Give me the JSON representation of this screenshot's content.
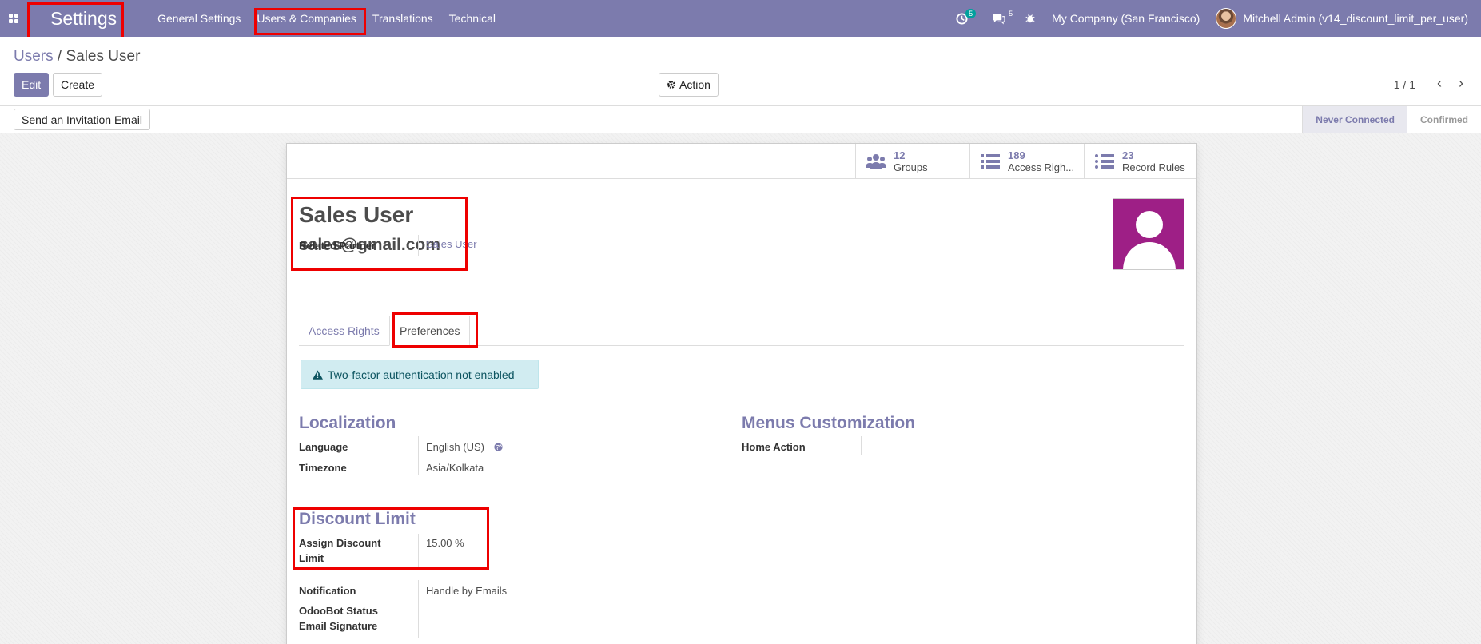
{
  "navbar": {
    "brand": "Settings",
    "menus": [
      "General Settings",
      "Users & Companies",
      "Translations",
      "Technical"
    ],
    "activity_count": "5",
    "message_count": "5",
    "company": "My Company (San Francisco)",
    "user": "Mitchell Admin (v14_discount_limit_per_user)"
  },
  "control_panel": {
    "breadcrumb_parent": "Users",
    "breadcrumb_sep": "/",
    "breadcrumb_current": "Sales User",
    "edit_label": "Edit",
    "create_label": "Create",
    "action_label": "Action",
    "pager": "1 / 1"
  },
  "statusbar": {
    "invite_label": "Send an Invitation Email",
    "steps": [
      "Never Connected",
      "Confirmed"
    ]
  },
  "stats": [
    {
      "count": "12",
      "label": "Groups",
      "icon": "users-icon"
    },
    {
      "count": "189",
      "label": "Access Righ...",
      "icon": "list-icon"
    },
    {
      "count": "23",
      "label": "Record Rules",
      "icon": "list-icon"
    }
  ],
  "record": {
    "name": "Sales User",
    "email": "sales@gmail.com",
    "related_partner_label": "Related Partner",
    "related_partner_value": "Sales User"
  },
  "tabs": [
    "Access Rights",
    "Preferences"
  ],
  "alert": "Two-factor authentication not enabled",
  "localization": {
    "title": "Localization",
    "language_label": "Language",
    "language_value": "English (US)",
    "timezone_label": "Timezone",
    "timezone_value": "Asia/Kolkata"
  },
  "menus_customization": {
    "title": "Menus Customization",
    "home_action_label": "Home Action"
  },
  "discount": {
    "title": "Discount Limit",
    "assign_label_1": "Assign Discount",
    "assign_label_2": "Limit",
    "assign_value": "15.00 %"
  },
  "other": {
    "notification_label": "Notification",
    "notification_value": "Handle by Emails",
    "odoobot_label": "OdooBot Status",
    "signature_label": "Email Signature"
  },
  "colors": {
    "brand": "#7c7bad",
    "highlight": "#ee0000",
    "avatar_bg": "#9e1f86"
  }
}
